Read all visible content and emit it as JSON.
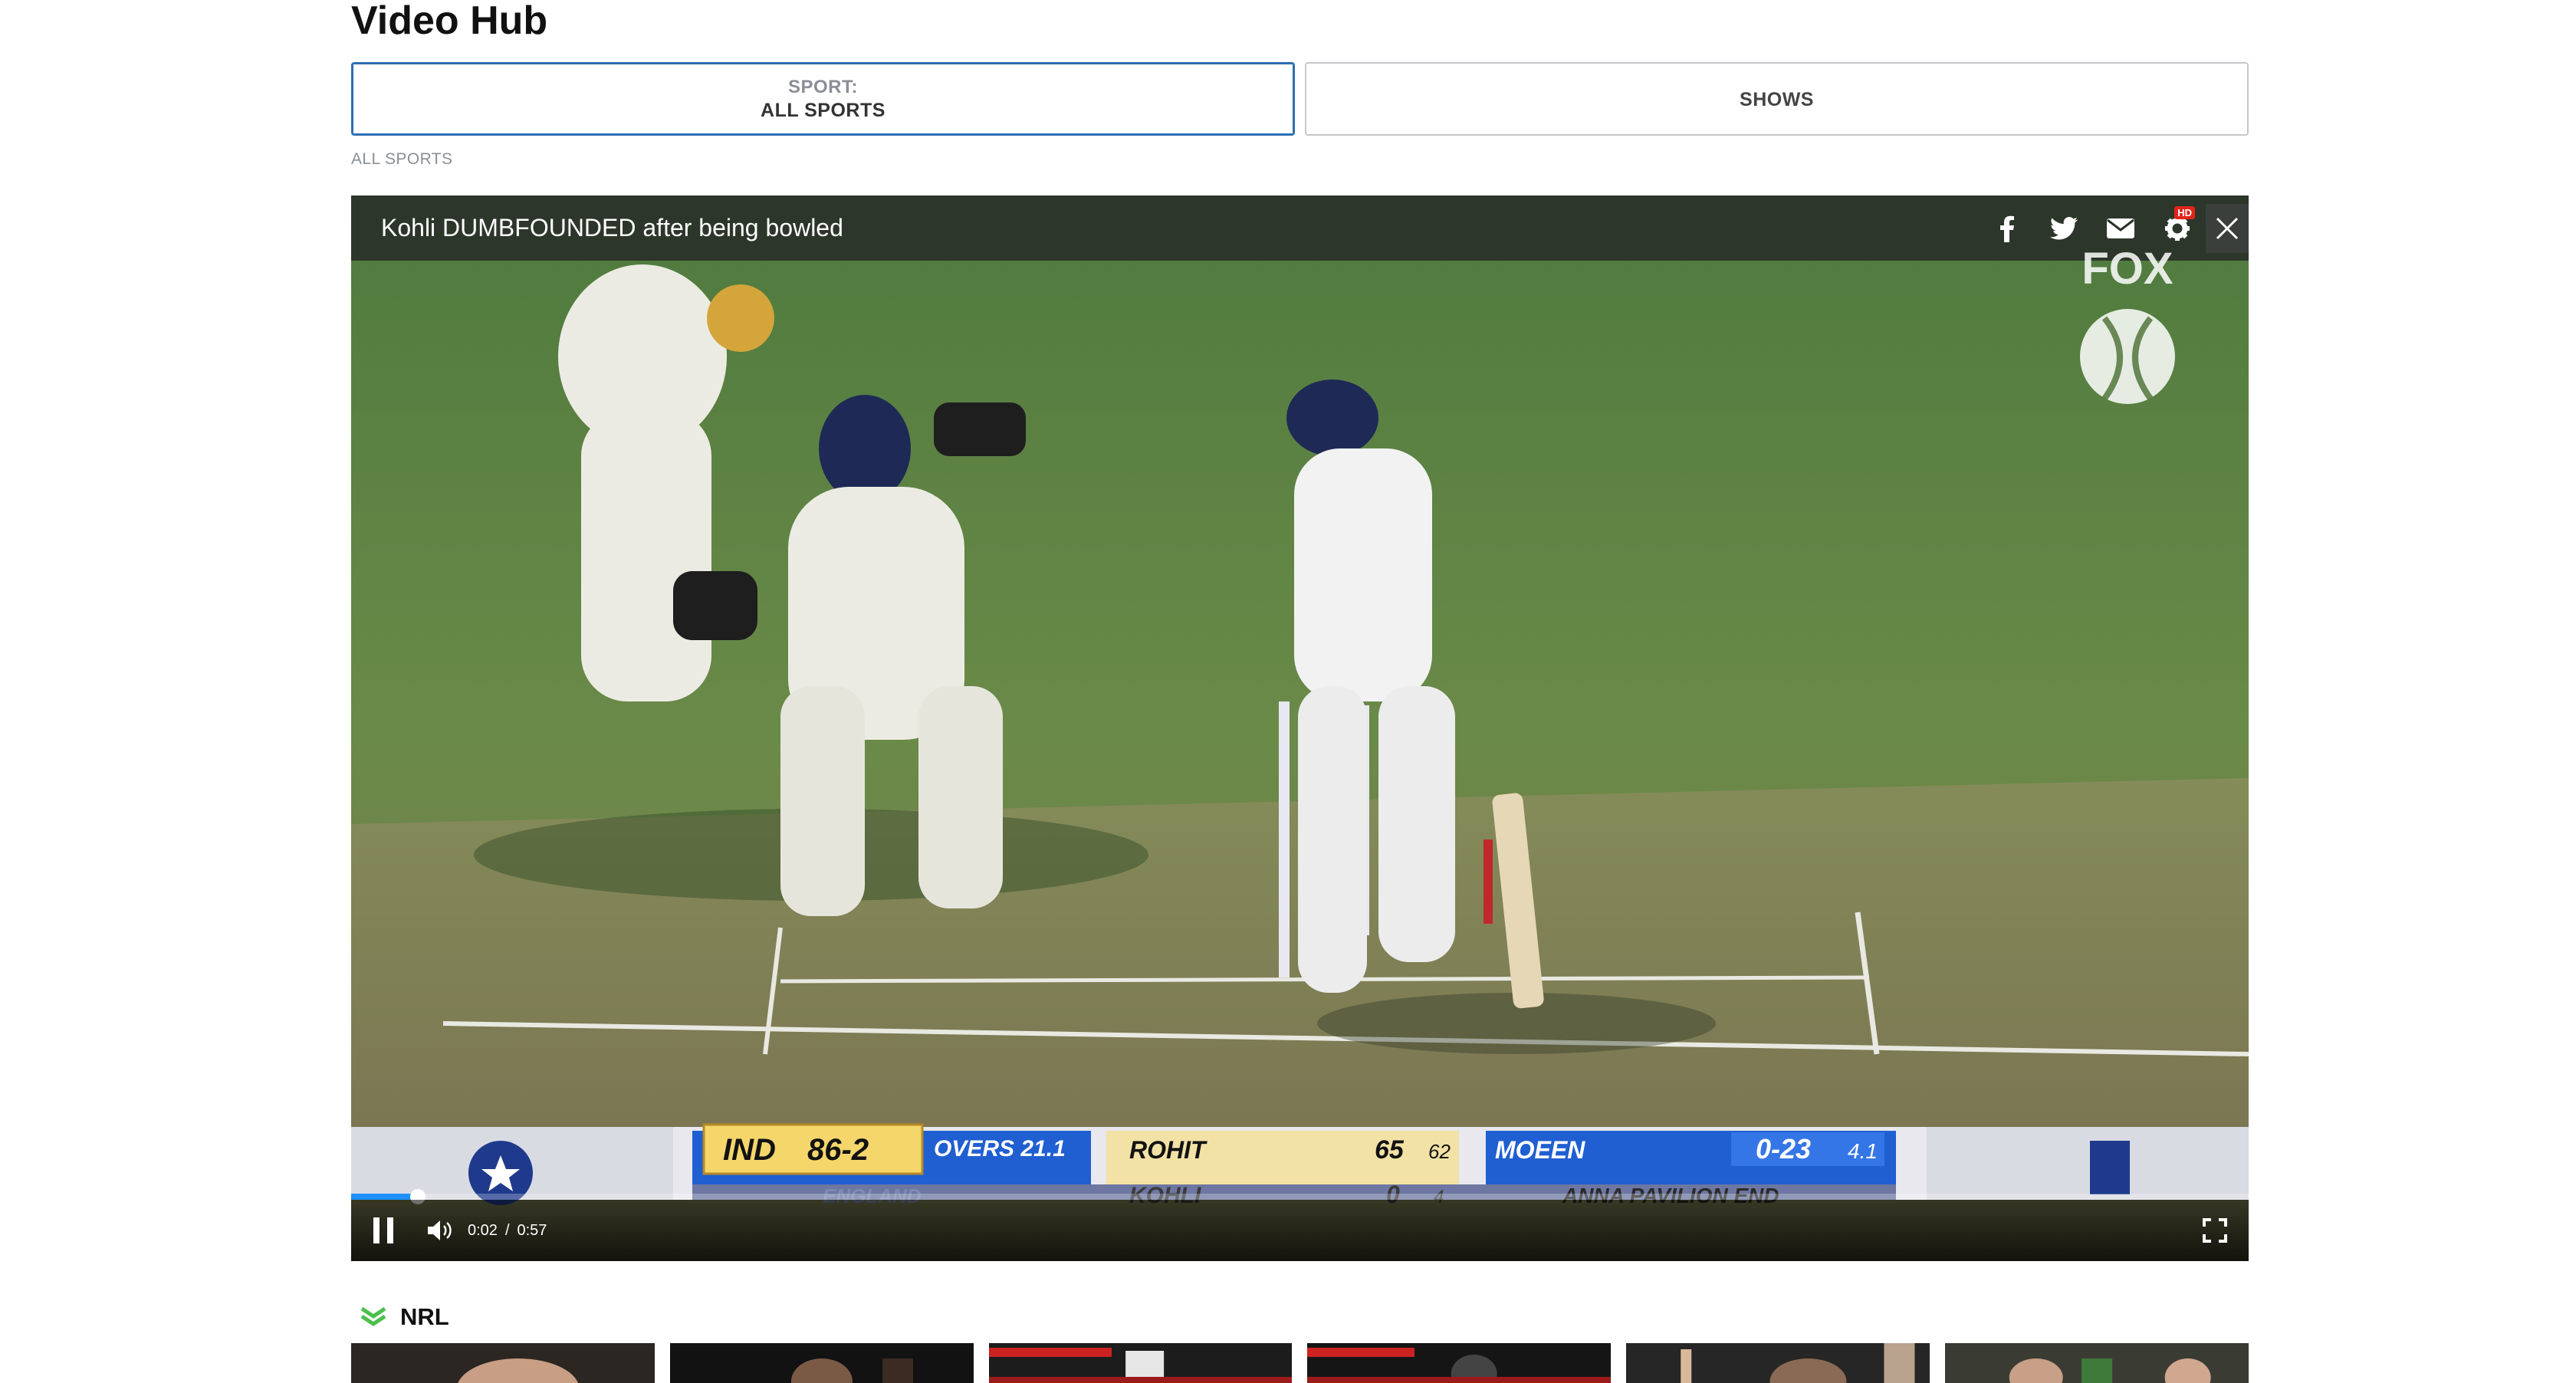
{
  "page": {
    "title": "Video Hub"
  },
  "filters": [
    {
      "label": "SPORT:",
      "value": "ALL SPORTS",
      "active": true
    },
    {
      "label": "",
      "value": "SHOWS",
      "active": false
    }
  ],
  "breadcrumb": "ALL SPORTS",
  "player": {
    "video_title": "Kohli DUMBFOUNDED after being bowled",
    "hd_badge": "HD",
    "icons": [
      "facebook-icon",
      "twitter-icon",
      "mail-icon",
      "gear-icon",
      "close-icon"
    ],
    "current_time": "0:02",
    "time_separator": "/",
    "duration": "0:57",
    "progress_fraction": 0.035,
    "loaded_fraction": 0.035
  },
  "scorebug": {
    "team": "IND",
    "score": "86-2",
    "overs": "OVERS 21.1",
    "opponent": "ENGLAND",
    "batter1": {
      "name": "ROHIT",
      "runs": "65",
      "balls": "62"
    },
    "batter2": {
      "name": "KOHLI",
      "runs": "0",
      "balls": "4"
    },
    "bowler": {
      "name": "MOEEN",
      "figures": "0-23",
      "overs": "4.1"
    },
    "end": "ANNA PAVILION END"
  },
  "watermark": "FOX",
  "section": {
    "title": "NRL"
  },
  "colors": {
    "accent_blue": "#2d6fb3",
    "progress": "#1e90ff",
    "nrl_green": "#4cbf4c"
  }
}
